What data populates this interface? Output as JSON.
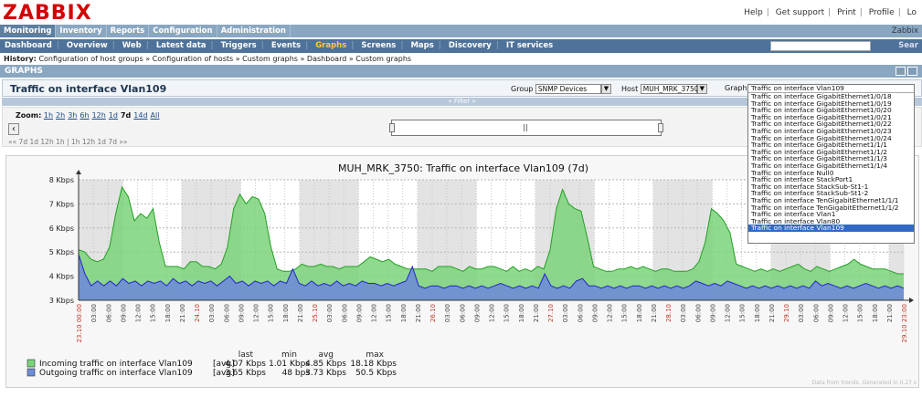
{
  "header": {
    "logo": "ZABBIX",
    "links": [
      "Help",
      "Get support",
      "Print",
      "Profile",
      "Lo"
    ]
  },
  "menu1": {
    "items": [
      "Monitoring",
      "Inventory",
      "Reports",
      "Configuration",
      "Administration"
    ],
    "active": "Monitoring",
    "right_text": "Zabbix"
  },
  "menu2": {
    "items": [
      "Dashboard",
      "Overview",
      "Web",
      "Latest data",
      "Triggers",
      "Events",
      "Graphs",
      "Screens",
      "Maps",
      "Discovery",
      "IT services"
    ],
    "active": "Graphs",
    "search_button": "Sear"
  },
  "history": {
    "label": "History:",
    "path": "Configuration of host groups » Configuration of hosts » Custom graphs » Dashboard » Custom graphs"
  },
  "section_title": "GRAPHS",
  "graph_title": "Traffic on interface Vlan109",
  "controls": {
    "group_label": "Group",
    "group_value": "SNMP Devices",
    "host_label": "Host",
    "host_value": "MUH_MRK_3750",
    "graph_label": "Graph"
  },
  "filter_label": "« Filter »",
  "zoom": {
    "label": "Zoom:",
    "options": [
      "1h",
      "2h",
      "3h",
      "6h",
      "12h",
      "1d",
      "7d",
      "14d",
      "All"
    ],
    "active": "7d",
    "nav_left": "«« 7d 1d 12h 1h",
    "nav_right": "1h 12h 1d 7d »»",
    "nav_sep": "|"
  },
  "dropdown": {
    "current": "Traffic on interface Vlan109",
    "options": [
      "Traffic on interface GigabitEthernet1/0/18",
      "Traffic on interface GigabitEthernet1/0/19",
      "Traffic on interface GigabitEthernet1/0/20",
      "Traffic on interface GigabitEthernet1/0/21",
      "Traffic on interface GigabitEthernet1/0/22",
      "Traffic on interface GigabitEthernet1/0/23",
      "Traffic on interface GigabitEthernet1/0/24",
      "Traffic on interface GigabitEthernet1/1/1",
      "Traffic on interface GigabitEthernet1/1/2",
      "Traffic on interface GigabitEthernet1/1/3",
      "Traffic on interface GigabitEthernet1/1/4",
      "Traffic on interface Null0",
      "Traffic on interface StackPort1",
      "Traffic on interface StackSub-St1-1",
      "Traffic on interface StackSub-St1-2",
      "Traffic on interface TenGigabitEthernet1/1/1",
      "Traffic on interface TenGigabitEthernet1/1/2",
      "Traffic on interface Vlan1",
      "Traffic on interface Vlan80",
      "Traffic on interface Vlan109"
    ],
    "selected": "Traffic on interface Vlan109"
  },
  "chart_data": {
    "type": "area",
    "title": "MUH_MRK_3750: Traffic on interface Vlan109 (7d)",
    "yticks": [
      "3 Kbps",
      "4 Kbps",
      "5 Kbps",
      "6 Kbps",
      "7 Kbps",
      "8 Kbps"
    ],
    "ylim": [
      3,
      8
    ],
    "xtick_labels": [
      "23.10 00:00",
      "03:00",
      "06:00",
      "09:00",
      "12:00",
      "15:00",
      "18:00",
      "21:00",
      "24.10",
      "03:00",
      "06:00",
      "09:00",
      "12:00",
      "15:00",
      "18:00",
      "21:00",
      "25.10",
      "03:00",
      "06:00",
      "09:00",
      "12:00",
      "15:00",
      "18:00",
      "21:00",
      "26.10",
      "03:00",
      "06:00",
      "09:00",
      "12:00",
      "15:00",
      "18:00",
      "21:00",
      "27.10",
      "03:00",
      "06:00",
      "09:00",
      "12:00",
      "15:00",
      "18:00",
      "21:00",
      "28.10",
      "03:00",
      "06:00",
      "09:00",
      "12:00",
      "15:00",
      "18:00",
      "21:00",
      "29.10",
      "03:00",
      "06:00",
      "09:00",
      "12:00",
      "15:00",
      "18:00",
      "21:00",
      "29.10 23:00"
    ],
    "grid": true,
    "series": [
      {
        "name": "Incoming traffic on interface Vlan109",
        "color": "#22a022",
        "fill": "#7bd37b",
        "values": [
          5.1,
          5.0,
          4.7,
          4.6,
          4.7,
          5.2,
          6.6,
          7.7,
          7.3,
          6.3,
          6.6,
          6.4,
          6.8,
          5.4,
          4.4,
          4.4,
          4.4,
          4.3,
          4.6,
          4.6,
          4.4,
          4.4,
          4.3,
          4.5,
          5.2,
          6.8,
          7.4,
          7.0,
          7.3,
          7.2,
          6.6,
          5.2,
          4.3,
          4.2,
          4.2,
          4.3,
          4.5,
          4.4,
          4.4,
          4.5,
          4.4,
          4.4,
          4.3,
          4.4,
          4.4,
          4.4,
          4.6,
          4.8,
          4.7,
          4.6,
          4.7,
          4.5,
          4.4,
          4.3,
          4.3,
          4.3,
          4.3,
          4.2,
          4.4,
          4.4,
          4.4,
          4.3,
          4.2,
          4.4,
          4.3,
          4.3,
          4.4,
          4.4,
          4.3,
          4.2,
          4.4,
          4.2,
          4.3,
          4.2,
          4.4,
          4.3,
          5.1,
          6.8,
          7.6,
          7.0,
          6.8,
          6.7,
          5.6,
          4.4,
          4.3,
          4.2,
          4.2,
          4.3,
          4.3,
          4.4,
          4.3,
          4.4,
          4.3,
          4.2,
          4.3,
          4.3,
          4.2,
          4.2,
          4.2,
          4.3,
          4.6,
          5.4,
          6.8,
          6.6,
          6.3,
          5.8,
          4.5,
          4.4,
          4.3,
          4.2,
          4.3,
          4.2,
          4.3,
          4.2,
          4.3,
          4.4,
          4.5,
          4.3,
          4.2,
          4.4,
          4.3,
          4.2,
          4.3,
          4.4,
          4.5,
          4.7,
          4.5,
          4.4,
          4.3,
          4.3,
          4.3,
          4.2,
          4.1,
          4.1
        ]
      },
      {
        "name": "Outgoing traffic on interface Vlan109",
        "color": "#2424c8",
        "fill": "#6e8cd6",
        "values": [
          4.9,
          4.1,
          3.6,
          3.8,
          3.6,
          3.8,
          3.6,
          3.9,
          3.7,
          3.8,
          3.6,
          3.8,
          3.7,
          3.8,
          3.6,
          3.9,
          3.7,
          3.8,
          3.6,
          3.8,
          3.7,
          3.8,
          3.6,
          3.8,
          4.0,
          3.7,
          3.8,
          3.6,
          3.8,
          3.7,
          3.8,
          3.6,
          3.8,
          3.7,
          4.3,
          3.7,
          3.6,
          3.8,
          3.6,
          3.7,
          3.6,
          3.8,
          3.6,
          3.7,
          3.6,
          3.8,
          3.7,
          3.7,
          3.6,
          3.7,
          3.6,
          3.7,
          3.8,
          4.4,
          3.6,
          3.5,
          3.6,
          3.6,
          3.5,
          3.6,
          3.6,
          3.5,
          3.6,
          3.5,
          3.6,
          3.5,
          3.6,
          3.7,
          3.6,
          3.5,
          3.6,
          3.5,
          3.6,
          3.5,
          4.1,
          3.6,
          3.5,
          3.6,
          3.5,
          3.8,
          3.9,
          3.6,
          3.6,
          3.5,
          3.6,
          3.5,
          3.6,
          3.5,
          3.6,
          3.6,
          3.5,
          3.6,
          3.5,
          3.6,
          3.5,
          3.6,
          3.5,
          3.6,
          3.8,
          3.7,
          3.6,
          3.7,
          3.6,
          3.8,
          3.7,
          3.6,
          3.5,
          3.6,
          3.5,
          3.6,
          3.5,
          3.6,
          3.5,
          3.6,
          3.5,
          3.6,
          3.5,
          3.8,
          3.6,
          3.7,
          3.6,
          3.5,
          3.6,
          3.5,
          3.6,
          3.7,
          3.6,
          3.5,
          3.6,
          3.5,
          3.6,
          3.5
        ]
      }
    ],
    "legend": {
      "headers": [
        "last",
        "min",
        "avg",
        "max"
      ],
      "rows": [
        {
          "name": "Incoming traffic on interface Vlan109",
          "agg": "[avg]",
          "last": "4.07 Kbps",
          "min": "1.01 Kbps",
          "avg": "4.85 Kbps",
          "max": "18.18 Kbps"
        },
        {
          "name": "Outgoing traffic on interface Vlan109",
          "agg": "[avg]",
          "last": "3.65 Kbps",
          "min": "48 bps",
          "avg": "3.73 Kbps",
          "max": "50.5 Kbps"
        }
      ]
    },
    "footer": "Data from trends. Generated in 0.27 s"
  }
}
